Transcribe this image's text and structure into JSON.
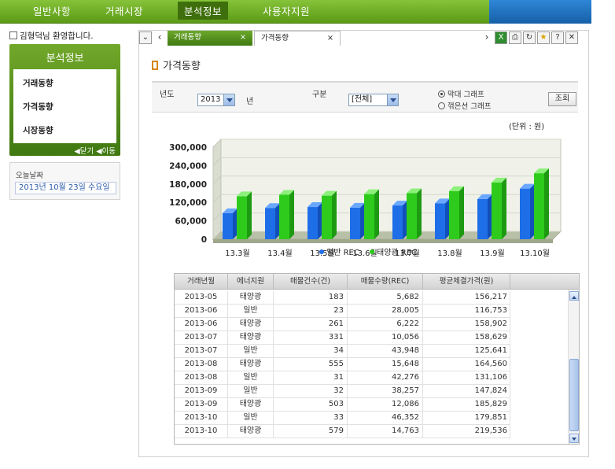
{
  "nav": {
    "items": [
      "일반사항",
      "거래시장",
      "분석정보",
      "사용자지원"
    ],
    "active_index": 2
  },
  "sidebar": {
    "welcome": "김형덕님 환영합니다.",
    "menu_title": "분석정보",
    "items": [
      "거래동향",
      "가격동향",
      "시장동향"
    ],
    "footer": "◀닫기 ◀이동",
    "today_label": "오늘날짜",
    "today_value": "2013년 10월 23일 수요일"
  },
  "tabs": {
    "items": [
      {
        "label": "거래동향",
        "close": "×",
        "active": false
      },
      {
        "label": "가격동향",
        "close": "×",
        "active": true
      }
    ]
  },
  "page": {
    "title": "가격동향"
  },
  "filter": {
    "year_label": "년도",
    "year_value": "2013",
    "year_suffix": "년",
    "type_label": "구분",
    "type_value": "[전체]",
    "radio_bar": "막대 그래프",
    "radio_line": "꺾은선 그래프",
    "radio_selected": "막대 그래프",
    "search_button": "조회"
  },
  "unit": "(단위 : 원)",
  "colors": {
    "nav_green": "#6aaa22",
    "general_bar": "#1e6ee8",
    "solar_bar": "#2ecb1c",
    "accent_orange": "#d6861a"
  },
  "chart_data": {
    "type": "bar",
    "categories": [
      "13.3월",
      "13.4월",
      "13.5월",
      "13.6월",
      "13.7월",
      "13.8월",
      "13.9월",
      "13.10월"
    ],
    "series": [
      {
        "name": "일반 REC",
        "values": [
          85000,
          102000,
          105000,
          103000,
          110000,
          117000,
          131000,
          165000
        ]
      },
      {
        "name": "태양광 REC",
        "values": [
          140000,
          145000,
          142000,
          147000,
          150000,
          157000,
          185000,
          215000
        ]
      }
    ],
    "ylim": [
      0,
      300000
    ],
    "yticks": [
      "0",
      "60,000",
      "120,000",
      "180,000",
      "240,000",
      "300,000"
    ],
    "legend": "bottom",
    "grid": true
  },
  "table": {
    "headers": [
      "거래년월",
      "에너지원",
      "매물건수(건)",
      "매물수량(REC)",
      "평균체결가격(원)"
    ],
    "rows": [
      [
        "2013-05",
        "태양광",
        "183",
        "5,682",
        "156,217"
      ],
      [
        "2013-06",
        "일반",
        "23",
        "28,005",
        "116,753"
      ],
      [
        "2013-06",
        "태양광",
        "261",
        "6,222",
        "158,902"
      ],
      [
        "2013-07",
        "태양광",
        "331",
        "10,056",
        "158,629"
      ],
      [
        "2013-07",
        "일반",
        "34",
        "43,948",
        "125,641"
      ],
      [
        "2013-08",
        "태양광",
        "555",
        "15,648",
        "164,560"
      ],
      [
        "2013-08",
        "일반",
        "31",
        "42,276",
        "131,106"
      ],
      [
        "2013-09",
        "일반",
        "32",
        "38,257",
        "147,824"
      ],
      [
        "2013-09",
        "태양광",
        "503",
        "12,086",
        "185,829"
      ],
      [
        "2013-10",
        "일반",
        "33",
        "46,352",
        "179,851"
      ],
      [
        "2013-10",
        "태양광",
        "579",
        "14,763",
        "219,536"
      ]
    ]
  }
}
